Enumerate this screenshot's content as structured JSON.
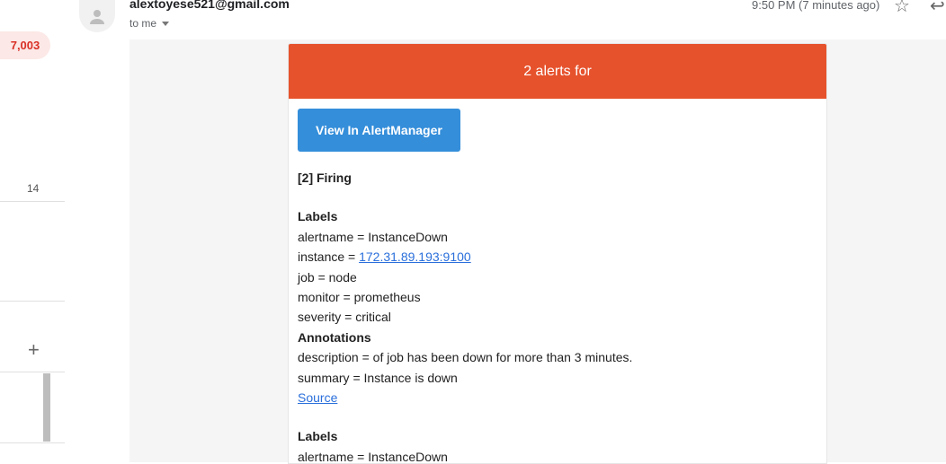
{
  "sidebar": {
    "inbox_count": "7,003",
    "other_count": "14",
    "plus_icon": "+"
  },
  "email": {
    "sender": "alextoyese521@gmail.com",
    "to": "to me",
    "time": "9:50 PM (7 minutes ago)"
  },
  "alert": {
    "header": "2 alerts for",
    "button_label": "View In AlertManager",
    "firing_title": "[2] Firing",
    "alerts": [
      {
        "labels_title": "Labels",
        "alertname": "alertname = InstanceDown",
        "instance_prefix": "instance = ",
        "instance_link": "172.31.89.193:9100",
        "job": "job = node",
        "monitor": "monitor = prometheus",
        "severity": "severity = critical",
        "annotations_title": "Annotations",
        "description": "description = of job has been down for more than 3 minutes.",
        "summary": "summary = Instance is down",
        "source_link": "Source"
      },
      {
        "labels_title": "Labels",
        "alertname": "alertname = InstanceDown"
      }
    ]
  },
  "colors": {
    "header_bg": "#e6522c",
    "button_bg": "#348eda",
    "badge_text": "#d93025"
  }
}
